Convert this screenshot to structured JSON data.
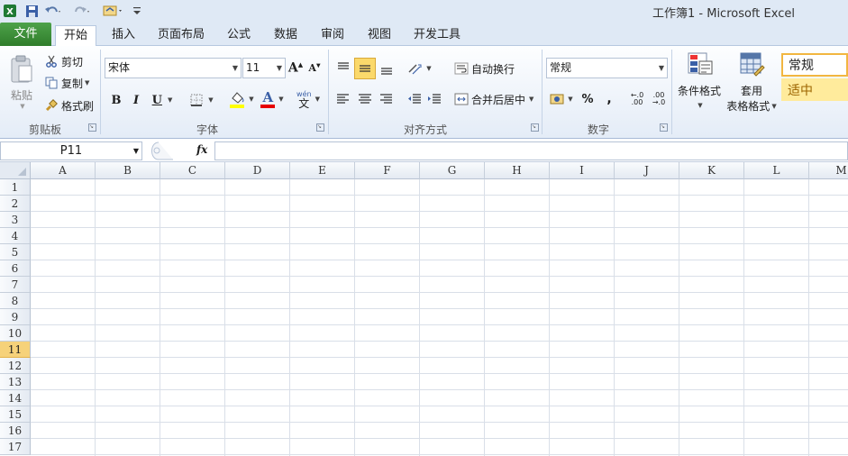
{
  "title": "工作簿1 - Microsoft Excel",
  "tabs": [
    {
      "label": "文件"
    },
    {
      "label": "开始"
    },
    {
      "label": "插入"
    },
    {
      "label": "页面布局"
    },
    {
      "label": "公式"
    },
    {
      "label": "数据"
    },
    {
      "label": "审阅"
    },
    {
      "label": "视图"
    },
    {
      "label": "开发工具"
    }
  ],
  "clipboard": {
    "paste_label": "粘贴",
    "cut_label": "剪切",
    "copy_label": "复制",
    "format_painter_label": "格式刷",
    "group_label": "剪贴板"
  },
  "font": {
    "family": "宋体",
    "size": "11",
    "bold": "B",
    "italic": "I",
    "underline": "U",
    "phonetic": "wén",
    "font_color_letter": "A",
    "group_label": "字体"
  },
  "alignment": {
    "wrap_label": "自动换行",
    "merge_label": "合并后居中",
    "group_label": "对齐方式"
  },
  "number": {
    "format": "常规",
    "percent": "%",
    "comma": ",",
    "group_label": "数字"
  },
  "styles": {
    "conditional_label": "条件格式",
    "table_label_1": "套用",
    "table_label_2": "表格格式",
    "style_normal": "常规",
    "style_neutral": "适中"
  },
  "formula_bar": {
    "name_box": "P11",
    "fx": "fx",
    "formula": ""
  },
  "columns": [
    "A",
    "B",
    "C",
    "D",
    "E",
    "F",
    "G",
    "H",
    "I",
    "J",
    "K",
    "L",
    "M"
  ],
  "rows": [
    "1",
    "2",
    "3",
    "4",
    "5",
    "6",
    "7",
    "8",
    "9",
    "10",
    "11",
    "12",
    "13",
    "14",
    "15",
    "16",
    "17"
  ],
  "selected_row": "11",
  "colors": {
    "file_tab": "#3c8f38",
    "selected_header": "#f6d27a",
    "neutral_style": "#ffeb9c"
  }
}
